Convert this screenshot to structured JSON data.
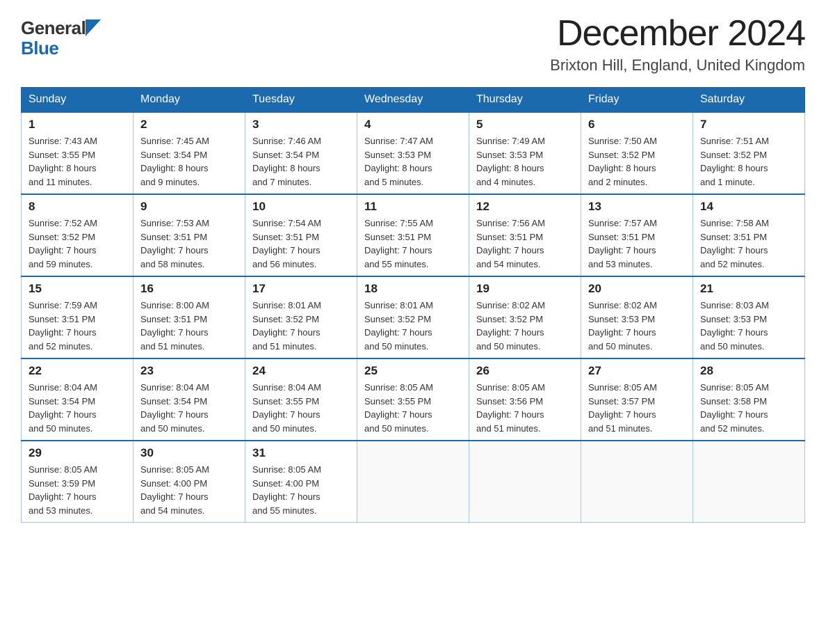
{
  "header": {
    "logo_general": "General",
    "logo_blue": "Blue",
    "month_year": "December 2024",
    "location": "Brixton Hill, England, United Kingdom"
  },
  "weekdays": [
    "Sunday",
    "Monday",
    "Tuesday",
    "Wednesday",
    "Thursday",
    "Friday",
    "Saturday"
  ],
  "weeks": [
    [
      {
        "day": "1",
        "sunrise": "7:43 AM",
        "sunset": "3:55 PM",
        "daylight": "8 hours and 11 minutes."
      },
      {
        "day": "2",
        "sunrise": "7:45 AM",
        "sunset": "3:54 PM",
        "daylight": "8 hours and 9 minutes."
      },
      {
        "day": "3",
        "sunrise": "7:46 AM",
        "sunset": "3:54 PM",
        "daylight": "8 hours and 7 minutes."
      },
      {
        "day": "4",
        "sunrise": "7:47 AM",
        "sunset": "3:53 PM",
        "daylight": "8 hours and 5 minutes."
      },
      {
        "day": "5",
        "sunrise": "7:49 AM",
        "sunset": "3:53 PM",
        "daylight": "8 hours and 4 minutes."
      },
      {
        "day": "6",
        "sunrise": "7:50 AM",
        "sunset": "3:52 PM",
        "daylight": "8 hours and 2 minutes."
      },
      {
        "day": "7",
        "sunrise": "7:51 AM",
        "sunset": "3:52 PM",
        "daylight": "8 hours and 1 minute."
      }
    ],
    [
      {
        "day": "8",
        "sunrise": "7:52 AM",
        "sunset": "3:52 PM",
        "daylight": "7 hours and 59 minutes."
      },
      {
        "day": "9",
        "sunrise": "7:53 AM",
        "sunset": "3:51 PM",
        "daylight": "7 hours and 58 minutes."
      },
      {
        "day": "10",
        "sunrise": "7:54 AM",
        "sunset": "3:51 PM",
        "daylight": "7 hours and 56 minutes."
      },
      {
        "day": "11",
        "sunrise": "7:55 AM",
        "sunset": "3:51 PM",
        "daylight": "7 hours and 55 minutes."
      },
      {
        "day": "12",
        "sunrise": "7:56 AM",
        "sunset": "3:51 PM",
        "daylight": "7 hours and 54 minutes."
      },
      {
        "day": "13",
        "sunrise": "7:57 AM",
        "sunset": "3:51 PM",
        "daylight": "7 hours and 53 minutes."
      },
      {
        "day": "14",
        "sunrise": "7:58 AM",
        "sunset": "3:51 PM",
        "daylight": "7 hours and 52 minutes."
      }
    ],
    [
      {
        "day": "15",
        "sunrise": "7:59 AM",
        "sunset": "3:51 PM",
        "daylight": "7 hours and 52 minutes."
      },
      {
        "day": "16",
        "sunrise": "8:00 AM",
        "sunset": "3:51 PM",
        "daylight": "7 hours and 51 minutes."
      },
      {
        "day": "17",
        "sunrise": "8:01 AM",
        "sunset": "3:52 PM",
        "daylight": "7 hours and 51 minutes."
      },
      {
        "day": "18",
        "sunrise": "8:01 AM",
        "sunset": "3:52 PM",
        "daylight": "7 hours and 50 minutes."
      },
      {
        "day": "19",
        "sunrise": "8:02 AM",
        "sunset": "3:52 PM",
        "daylight": "7 hours and 50 minutes."
      },
      {
        "day": "20",
        "sunrise": "8:02 AM",
        "sunset": "3:53 PM",
        "daylight": "7 hours and 50 minutes."
      },
      {
        "day": "21",
        "sunrise": "8:03 AM",
        "sunset": "3:53 PM",
        "daylight": "7 hours and 50 minutes."
      }
    ],
    [
      {
        "day": "22",
        "sunrise": "8:04 AM",
        "sunset": "3:54 PM",
        "daylight": "7 hours and 50 minutes."
      },
      {
        "day": "23",
        "sunrise": "8:04 AM",
        "sunset": "3:54 PM",
        "daylight": "7 hours and 50 minutes."
      },
      {
        "day": "24",
        "sunrise": "8:04 AM",
        "sunset": "3:55 PM",
        "daylight": "7 hours and 50 minutes."
      },
      {
        "day": "25",
        "sunrise": "8:05 AM",
        "sunset": "3:55 PM",
        "daylight": "7 hours and 50 minutes."
      },
      {
        "day": "26",
        "sunrise": "8:05 AM",
        "sunset": "3:56 PM",
        "daylight": "7 hours and 51 minutes."
      },
      {
        "day": "27",
        "sunrise": "8:05 AM",
        "sunset": "3:57 PM",
        "daylight": "7 hours and 51 minutes."
      },
      {
        "day": "28",
        "sunrise": "8:05 AM",
        "sunset": "3:58 PM",
        "daylight": "7 hours and 52 minutes."
      }
    ],
    [
      {
        "day": "29",
        "sunrise": "8:05 AM",
        "sunset": "3:59 PM",
        "daylight": "7 hours and 53 minutes."
      },
      {
        "day": "30",
        "sunrise": "8:05 AM",
        "sunset": "4:00 PM",
        "daylight": "7 hours and 54 minutes."
      },
      {
        "day": "31",
        "sunrise": "8:05 AM",
        "sunset": "4:00 PM",
        "daylight": "7 hours and 55 minutes."
      },
      null,
      null,
      null,
      null
    ]
  ],
  "labels": {
    "sunrise": "Sunrise:",
    "sunset": "Sunset:",
    "daylight": "Daylight:"
  }
}
